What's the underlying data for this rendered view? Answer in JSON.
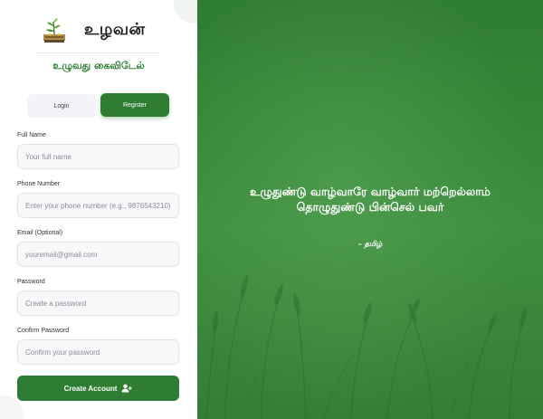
{
  "brand": {
    "name": "உழவன்",
    "tagline": "உழுவது கைவிடேல்"
  },
  "tabs": {
    "login": "Login",
    "register": "Register",
    "active": "register"
  },
  "form": {
    "full_name": {
      "label": "Full Name",
      "placeholder": "Your full name"
    },
    "phone": {
      "label": "Phone Number",
      "placeholder": "Enter your phone number (e.g., 9876543210)"
    },
    "email": {
      "label": "Email (Optional)",
      "placeholder": "youremail@gmail.com"
    },
    "password": {
      "label": "Password",
      "placeholder": "Create a password"
    },
    "confirm_password": {
      "label": "Confirm Password",
      "placeholder": "Confirm your password"
    },
    "submit_label": "Create Account",
    "submit_icon": "user-plus-icon"
  },
  "hero": {
    "quote": "உழுதுண்டு வாழ்வாரே வாழ்வார் மற்றெல்லாம் தொழுதுண்டு பின்செல் பவர்",
    "attribution": "– தமிழ்"
  },
  "colors": {
    "accent": "#2e7d32",
    "hero_green": "#3e8f3f"
  }
}
